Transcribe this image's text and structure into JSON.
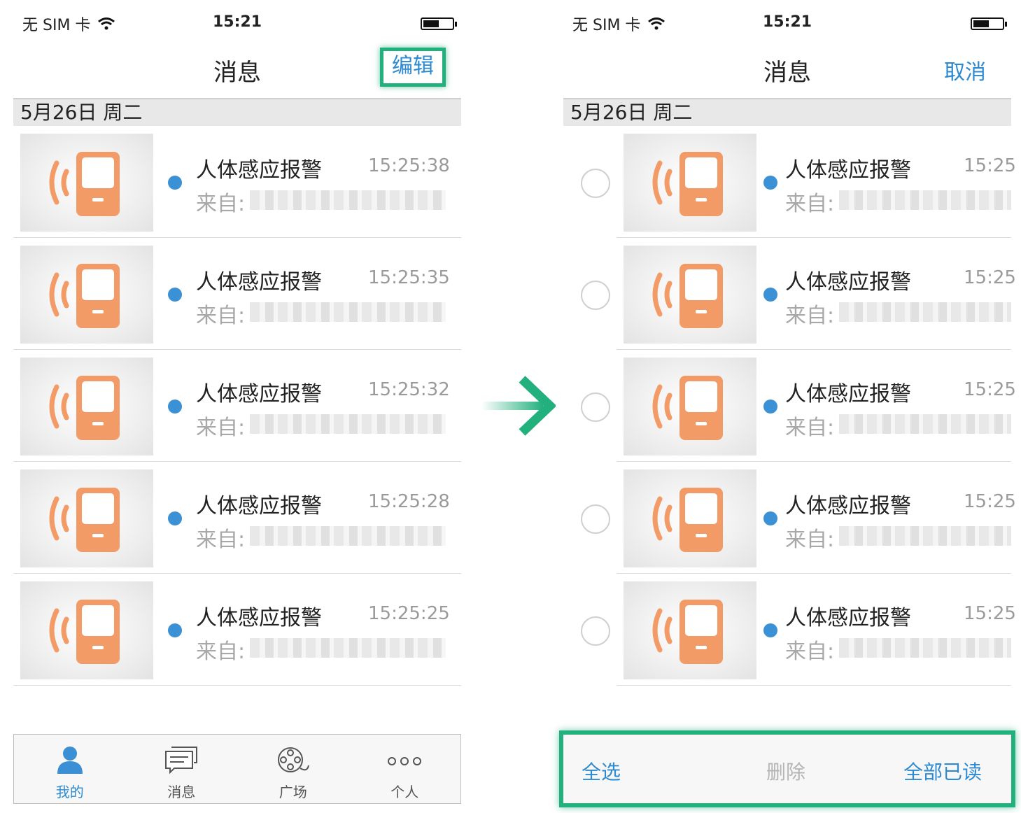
{
  "status_bar": {
    "carrier": "无 SIM 卡",
    "time": "15:21"
  },
  "left_screen": {
    "nav": {
      "title": "消息",
      "edit_label": "编辑"
    },
    "date_header": "5月26日  周二",
    "messages": [
      {
        "title": "人体感应报警",
        "time": "15:25:38",
        "from_label": "来自:"
      },
      {
        "title": "人体感应报警",
        "time": "15:25:35",
        "from_label": "来自:"
      },
      {
        "title": "人体感应报警",
        "time": "15:25:32",
        "from_label": "来自:"
      },
      {
        "title": "人体感应报警",
        "time": "15:25:28",
        "from_label": "来自:"
      },
      {
        "title": "人体感应报警",
        "time": "15:25:25",
        "from_label": "来自:"
      }
    ],
    "tabs": [
      {
        "label": "我的",
        "icon": "person-icon",
        "active": true
      },
      {
        "label": "消息",
        "icon": "message-icon",
        "active": false
      },
      {
        "label": "广场",
        "icon": "film-reel-icon",
        "active": false
      },
      {
        "label": "个人",
        "icon": "more-dots-icon",
        "active": false
      }
    ]
  },
  "right_screen": {
    "nav": {
      "title": "消息",
      "cancel_label": "取消"
    },
    "date_header": "5月26日  周二",
    "messages": [
      {
        "title": "人体感应报警",
        "time": "15:25",
        "from_label": "来自:"
      },
      {
        "title": "人体感应报警",
        "time": "15:25",
        "from_label": "来自:"
      },
      {
        "title": "人体感应报警",
        "time": "15:25",
        "from_label": "来自:"
      },
      {
        "title": "人体感应报警",
        "time": "15:25",
        "from_label": "来自:"
      },
      {
        "title": "人体感应报警",
        "time": "15:25",
        "from_label": "来自:"
      }
    ],
    "actions": {
      "select_all": "全选",
      "delete": "删除",
      "mark_all_read": "全部已读"
    }
  },
  "colors": {
    "accent": "#2d8ad0",
    "highlight": "#22b07d",
    "unread_dot": "#3a91d6",
    "alarm_orange": "#f29b66"
  }
}
